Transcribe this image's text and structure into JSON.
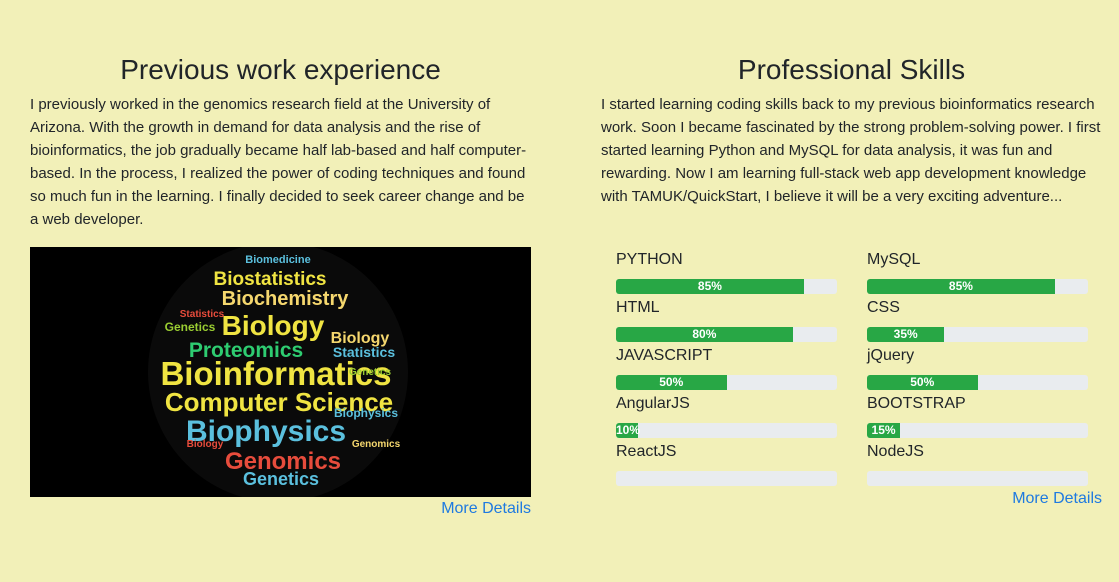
{
  "left": {
    "title": "Previous work experience",
    "description": "I previously worked in the genomics research field at the University of Arizona. With the growth in demand for data analysis and the rise of bioinformatics, the job gradually became half lab-based and half computer-based. In the process, I realized the power of coding techniques and found so much fun in the learning. I finally decided to seek career change and be a web developer.",
    "more_label": "More Details",
    "word_cloud": {
      "words": [
        "Bioinformatics",
        "Biophysics",
        "Computer Science",
        "Biology",
        "Genomics",
        "Biochemistry",
        "Proteomics",
        "Biostatistics",
        "Biomedicine",
        "Genetics",
        "Statistics"
      ]
    }
  },
  "right": {
    "title": "Professional Skills",
    "description": "I started learning coding skills back to my previous bioinformatics research work. Soon I became fascinated by the strong problem-solving power. I first started learning Python and MySQL for data analysis, it was fun and rewarding. Now I am learning full-stack web app development knowledge with TAMUK/QuickStart, I believe it will be a very exciting adventure...",
    "more_label": "More Details",
    "skills": [
      {
        "name": "PYTHON",
        "percent": 85,
        "label": "85%"
      },
      {
        "name": "MySQL",
        "percent": 85,
        "label": "85%"
      },
      {
        "name": "HTML",
        "percent": 80,
        "label": "80%"
      },
      {
        "name": "CSS",
        "percent": 35,
        "label": "35%"
      },
      {
        "name": "JAVASCRIPT",
        "percent": 50,
        "label": "50%"
      },
      {
        "name": "jQuery",
        "percent": 50,
        "label": "50%"
      },
      {
        "name": "AngularJS",
        "percent": 10,
        "label": "10%"
      },
      {
        "name": "BOOTSTRAP",
        "percent": 15,
        "label": "15%"
      },
      {
        "name": "ReactJS",
        "percent": 0,
        "label": ""
      },
      {
        "name": "NodeJS",
        "percent": 0,
        "label": ""
      }
    ]
  },
  "colors": {
    "background": "#f2f0b8",
    "bar_fill": "#28a745",
    "bar_track": "#e9ecef",
    "link": "#1f7ae0"
  }
}
